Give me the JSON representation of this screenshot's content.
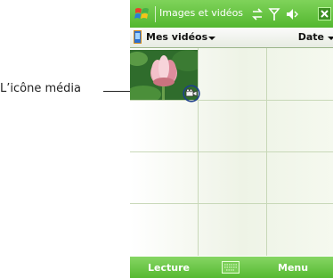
{
  "annotation": {
    "label": "L’icône média"
  },
  "titlebar": {
    "title": "Images et vidéos"
  },
  "folderbar": {
    "folder": "Mes vidéos",
    "sort": "Date"
  },
  "softkeys": {
    "left": "Lecture",
    "right": "Menu"
  },
  "colors": {
    "titlebar_green": "#53b72f",
    "bottombar_green": "#56b932",
    "grid_line": "#c8d8b8"
  },
  "icons": [
    "windows-start-icon",
    "sync-icon",
    "signal-icon",
    "volume-icon",
    "close-icon",
    "media-folder-icon",
    "video-media-icon",
    "keyboard-icon"
  ]
}
